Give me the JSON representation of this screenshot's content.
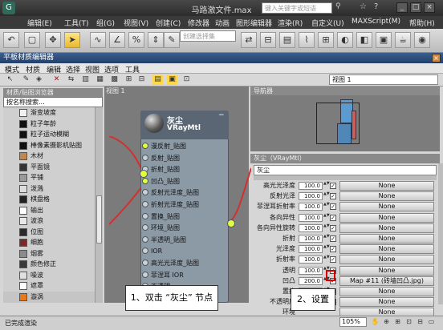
{
  "window": {
    "title": "马路激文件.max",
    "search_placeholder": "键入关键字或短语"
  },
  "main_menu": [
    "编辑(E)",
    "工具(T)",
    "组(G)",
    "视图(V)",
    "创建(C)",
    "修改器",
    "动画",
    "图形编辑器",
    "渲染(R)",
    "自定义(U)",
    "MAXScript(M)",
    "帮助(H)"
  ],
  "toolbar": {
    "selection_set_placeholder": "创建选择集"
  },
  "sme": {
    "title": "平板材质编辑器",
    "menu": [
      "模式",
      "材质",
      "编辑",
      "选择",
      "视图",
      "选项",
      "工具"
    ],
    "view_dropdown": "视图 1"
  },
  "browser": {
    "header": "材质/贴图浏览器",
    "search_placeholder": "按名称搜索...",
    "items": [
      {
        "label": "渐变坡度",
        "color": "#f0f0f0"
      },
      {
        "label": "粒子年龄",
        "color": "#111111"
      },
      {
        "label": "粒子运动模糊",
        "color": "#111111"
      },
      {
        "label": "棒像素摄影机贴图",
        "color": "#111111"
      },
      {
        "label": "木材",
        "color": "#c08850"
      },
      {
        "label": "平面镜",
        "color": "#333333"
      },
      {
        "label": "平铺",
        "color": "#9a9a9a"
      },
      {
        "label": "泼溅",
        "color": "#dddddd"
      },
      {
        "label": "棋盘格",
        "color": "#222222"
      },
      {
        "label": "输出",
        "color": "#ffffff"
      },
      {
        "label": "波浪",
        "color": "#e8e8e8"
      },
      {
        "label": "位图",
        "color": "#2a2a2a"
      },
      {
        "label": "细胞",
        "color": "#7a2a2a"
      },
      {
        "label": "烟雾",
        "color": "#8a8a8a"
      },
      {
        "label": "颜色修正",
        "color": "#3a3a3a"
      },
      {
        "label": "噪波",
        "color": "#e0e0e0"
      },
      {
        "label": "遮罩",
        "color": "#ffffff"
      },
      {
        "label": "漩涡",
        "color": "#e87818"
      }
    ]
  },
  "view": {
    "tab": "视图 1"
  },
  "node": {
    "name": "灰尘",
    "type": "VRayMtl",
    "slots": [
      "漫反射_贴图",
      "反射_贴图",
      "折射_贴图",
      "凹凸_贴图",
      "反射光泽度_贴图",
      "折射光泽度_贴图",
      "置换_贴图",
      "环境_贴图",
      "半透明_贴图",
      "IOR",
      "高光光泽度_贴图",
      "菲涅耳 IOR",
      "不透明",
      "粗糙度_贴图"
    ]
  },
  "navigator": {
    "header": "导航器"
  },
  "params": {
    "header": "灰尘（VRayMtl）",
    "material_name": "灰尘",
    "rows": [
      {
        "label": "高光光泽度",
        "value": "100.0",
        "map": "None"
      },
      {
        "label": "反射光泽",
        "value": "100.0",
        "map": "None"
      },
      {
        "label": "菲涅耳折射率",
        "value": "100.0",
        "map": "None"
      },
      {
        "label": "各向异性",
        "value": "100.0",
        "map": "None"
      },
      {
        "label": "各向异性旋转",
        "value": "100.0",
        "map": "None"
      },
      {
        "label": "折射",
        "value": "100.0",
        "map": "None"
      },
      {
        "label": "光泽度",
        "value": "100.0",
        "map": "None"
      },
      {
        "label": "折射率",
        "value": "100.0",
        "map": "None"
      },
      {
        "label": "透明",
        "value": "100.0",
        "map": "None"
      },
      {
        "label": "凹凸",
        "value": "200.0",
        "map": "Map #11 (砖墙凹凸.jpg)"
      },
      {
        "label": "置换",
        "value": "100.0",
        "map": "None"
      },
      {
        "label": "不透明度",
        "value": "100.0",
        "map": "None"
      },
      {
        "label": "环境",
        "value": "",
        "map": "None"
      }
    ]
  },
  "status": {
    "text": "已完成渲染",
    "zoom": "105%"
  },
  "callouts": {
    "step1": "1、双击 “灰尘” 节点",
    "step2": "2、设置"
  }
}
